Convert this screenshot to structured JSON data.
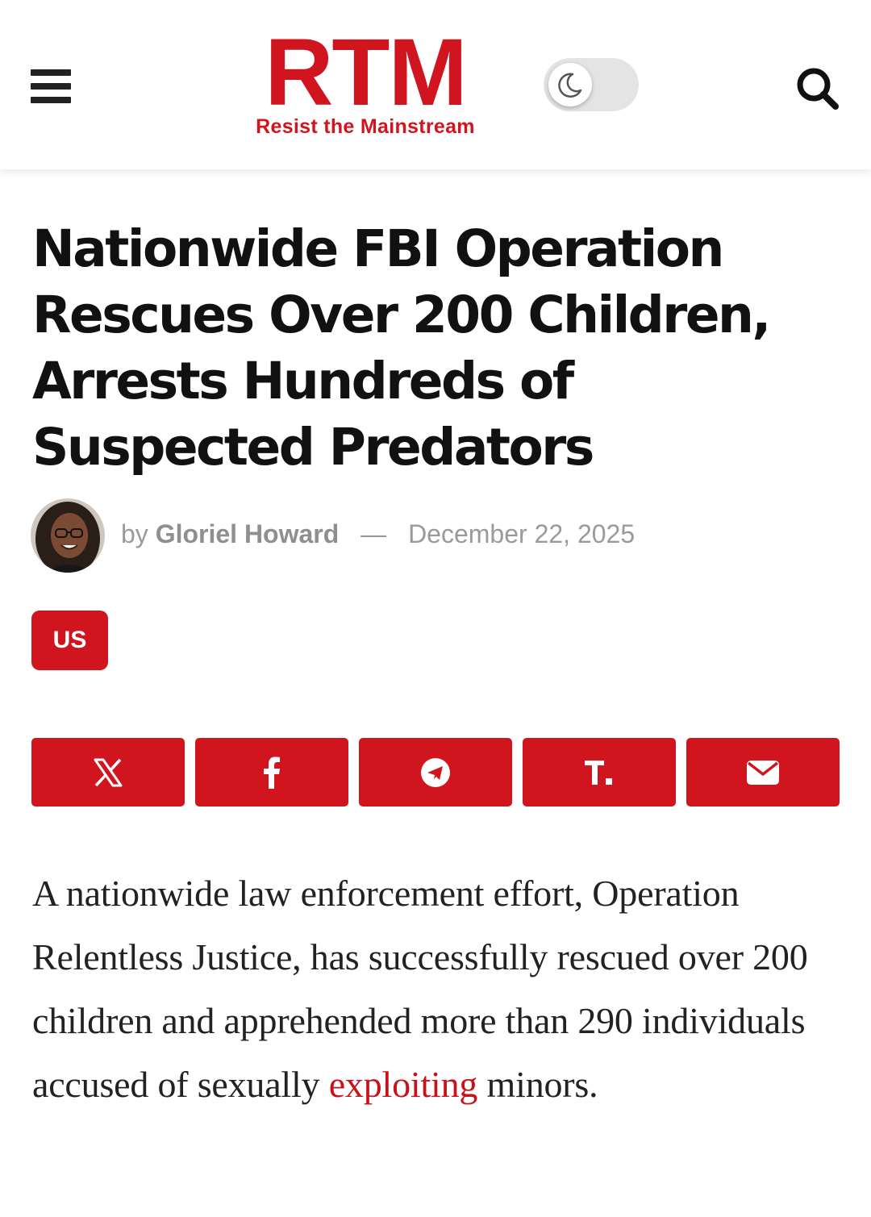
{
  "header": {
    "logo_text": "RTM",
    "logo_tagline": "Resist the Mainstream",
    "menu_icon": "hamburger-menu-icon",
    "theme_toggle_icon": "moon-icon",
    "search_icon": "search-icon"
  },
  "article": {
    "title": "Nationwide FBI Operation Rescues Over 200 Children, Arrests Hundreds of Suspected Predators",
    "byline_prefix": "by",
    "author": "Gloriel Howard",
    "separator": "—",
    "date": "December 22, 2025",
    "category": "US",
    "share_buttons": [
      {
        "icon": "x-icon"
      },
      {
        "icon": "facebook-icon"
      },
      {
        "icon": "telegram-icon"
      },
      {
        "icon": "truth-social-icon"
      },
      {
        "icon": "email-icon"
      }
    ],
    "body_before_link": "A nationwide law enforcement effort, Operation Relentless Justice, has successfully rescued over 200 children and apprehended more than 290 individuals accused of sexually ",
    "body_link": "exploiting",
    "body_after_link": " minors."
  },
  "colors": {
    "brand_red": "#d0151f",
    "link_red": "#c8111b",
    "meta_gray": "#9a9a9a"
  }
}
